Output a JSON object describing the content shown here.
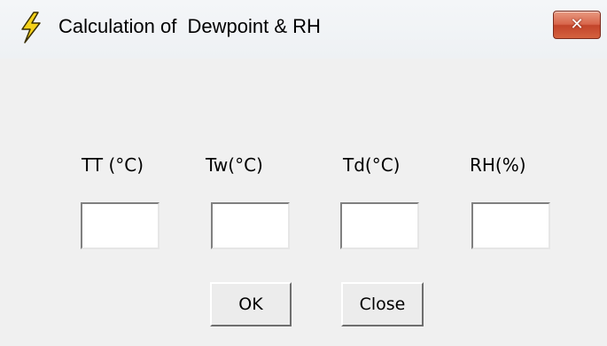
{
  "window": {
    "title": "Calculation of  Dewpoint & RH",
    "app_icon": "lightning-bolt-icon",
    "close_icon": "close-icon",
    "close_glyph": "✕",
    "accent_colors": {
      "close_button": "#d4623f",
      "icon_yellow": "#f5d21a"
    }
  },
  "fields": [
    {
      "label": "TT (°C)",
      "value": ""
    },
    {
      "label": "Tw(°C)",
      "value": ""
    },
    {
      "label": "Td(°C)",
      "value": ""
    },
    {
      "label": "RH(%)",
      "value": ""
    }
  ],
  "buttons": {
    "ok": "OK",
    "close": "Close"
  }
}
